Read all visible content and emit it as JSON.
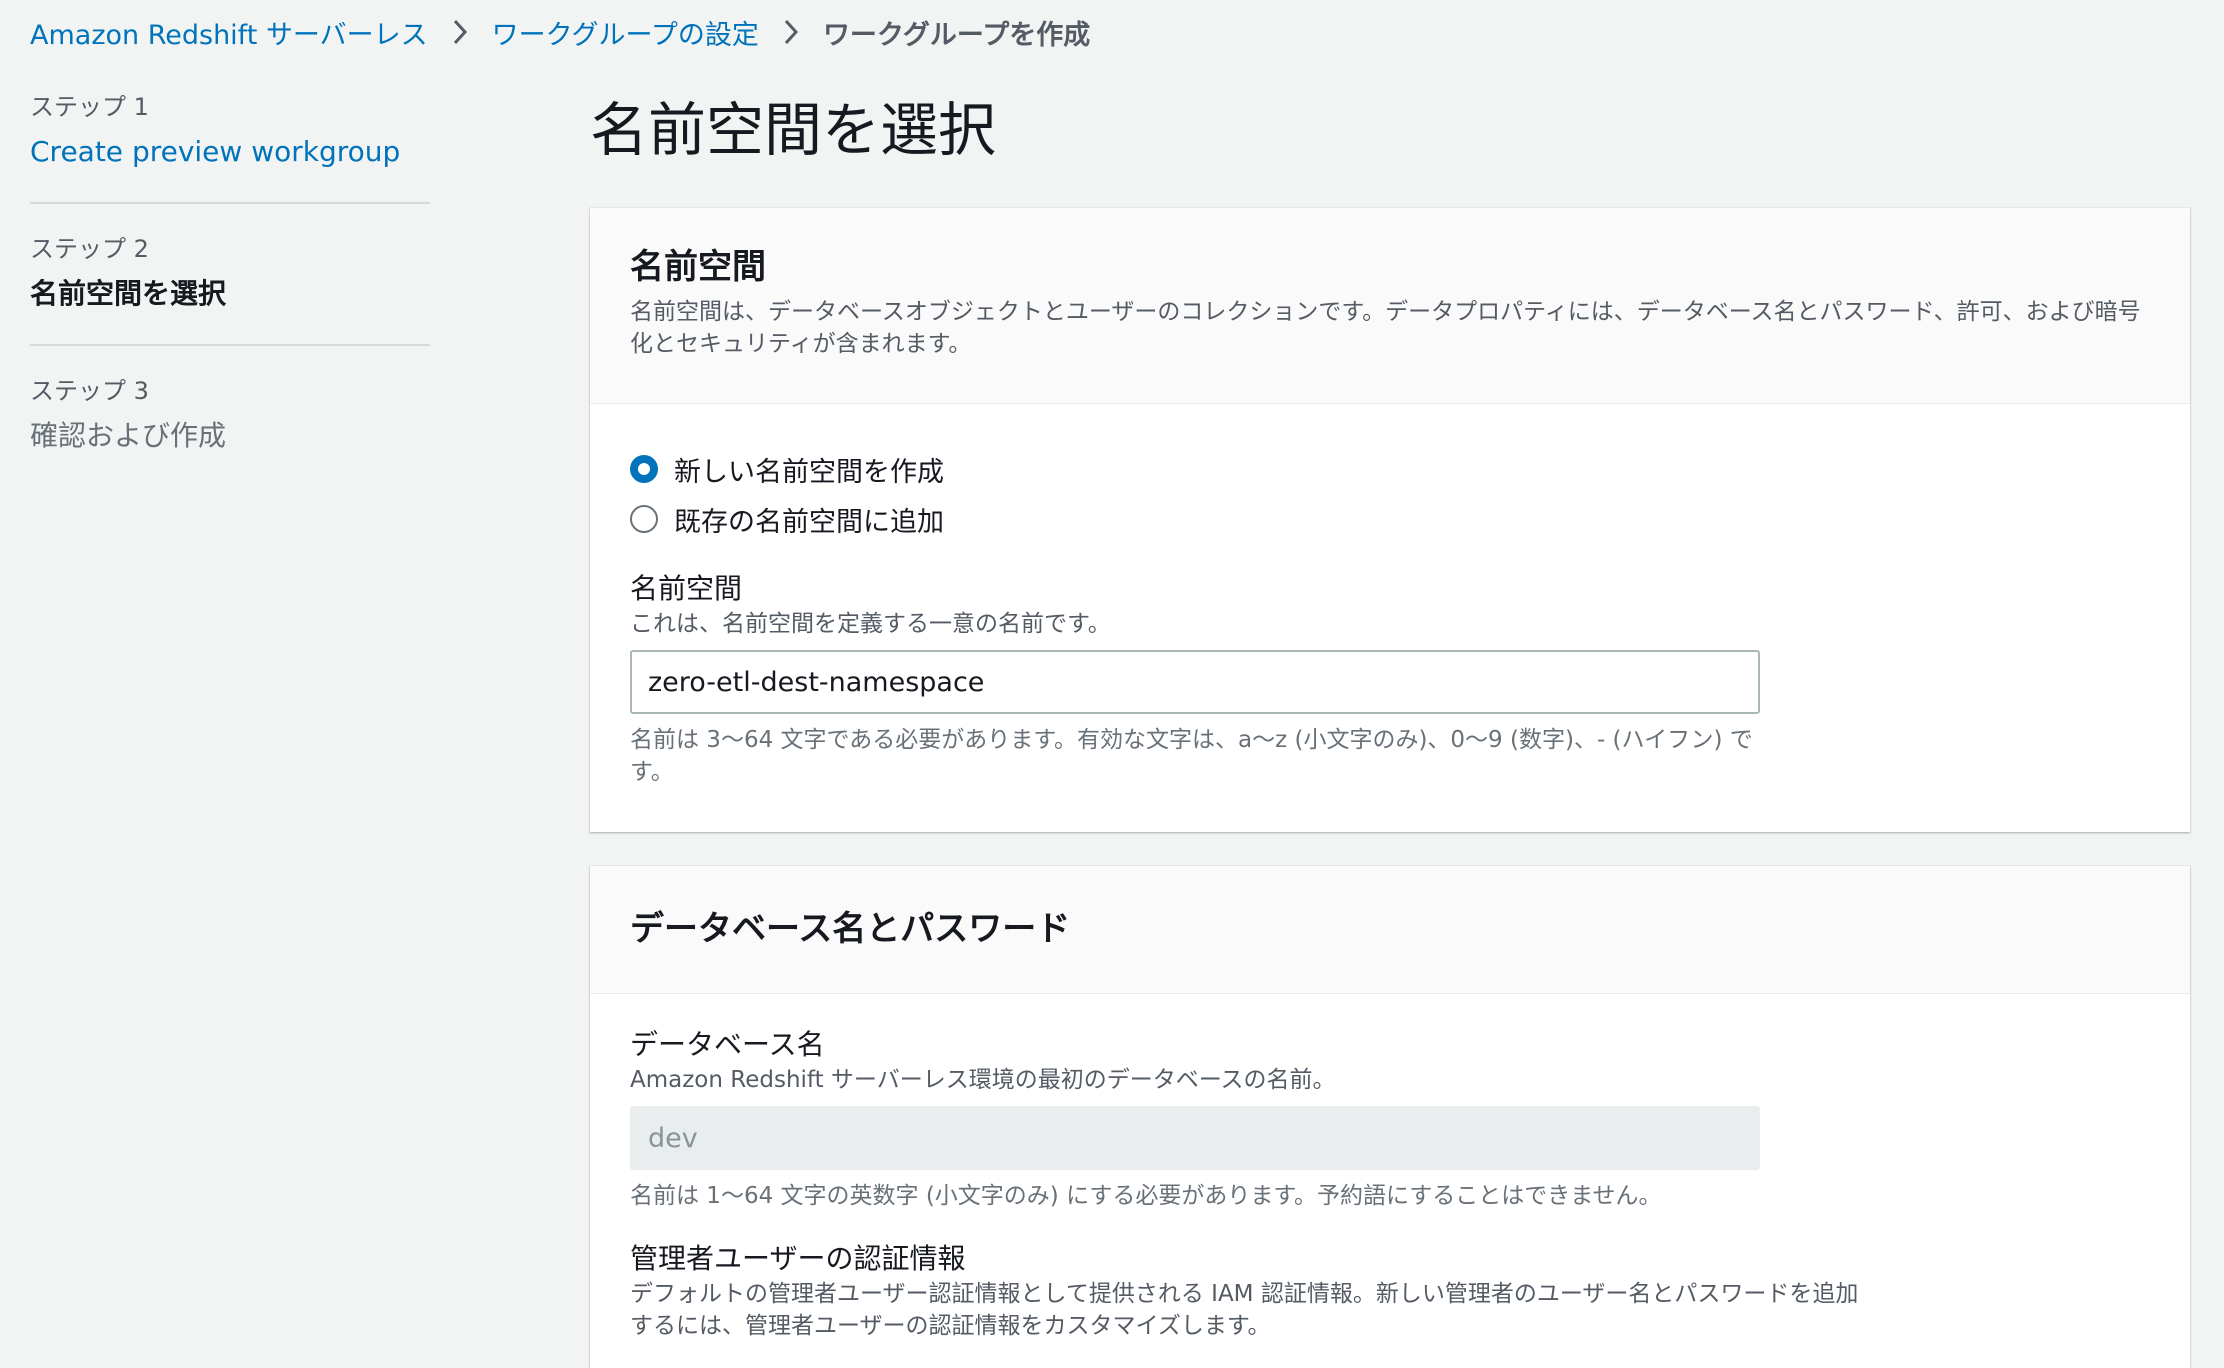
{
  "breadcrumb": {
    "items": [
      "Amazon Redshift サーバーレス",
      "ワークグループの設定"
    ],
    "current": "ワークグループを作成"
  },
  "steps": [
    {
      "num": "ステップ 1",
      "title": "Create preview workgroup"
    },
    {
      "num": "ステップ 2",
      "title": "名前空間を選択"
    },
    {
      "num": "ステップ 3",
      "title": "確認および作成"
    }
  ],
  "page_title": "名前空間を選択",
  "namespace_panel": {
    "title": "名前空間",
    "description": "名前空間は、データベースオブジェクトとユーザーのコレクションです。データプロパティには、データベース名とパスワード、許可、および暗号化とセキュリティが含まれます。",
    "options": [
      {
        "label": "新しい名前空間を作成",
        "checked": true
      },
      {
        "label": "既存の名前空間に追加",
        "checked": false
      }
    ],
    "field_label": "名前空間",
    "field_desc": "これは、名前空間を定義する一意の名前です。",
    "value": "zero-etl-dest-namespace",
    "constraint": "名前は 3〜64 文字である必要があります。有効な文字は、a〜z (小文字のみ)、0〜9 (数字)、- (ハイフン) です。"
  },
  "db_panel": {
    "title": "データベース名とパスワード",
    "db_label": "データベース名",
    "db_desc": "Amazon Redshift サーバーレス環境の最初のデータベースの名前。",
    "db_value": "dev",
    "db_constraint": "名前は 1〜64 文字の英数字 (小文字のみ) にする必要があります。予約語にすることはできません。",
    "admin_label": "管理者ユーザーの認証情報",
    "admin_desc": "デフォルトの管理者ユーザー認証情報として提供される IAM 認証情報。新しい管理者のユーザー名とパスワードを追加するには、管理者ユーザーの認証情報をカスタマイズします。"
  }
}
